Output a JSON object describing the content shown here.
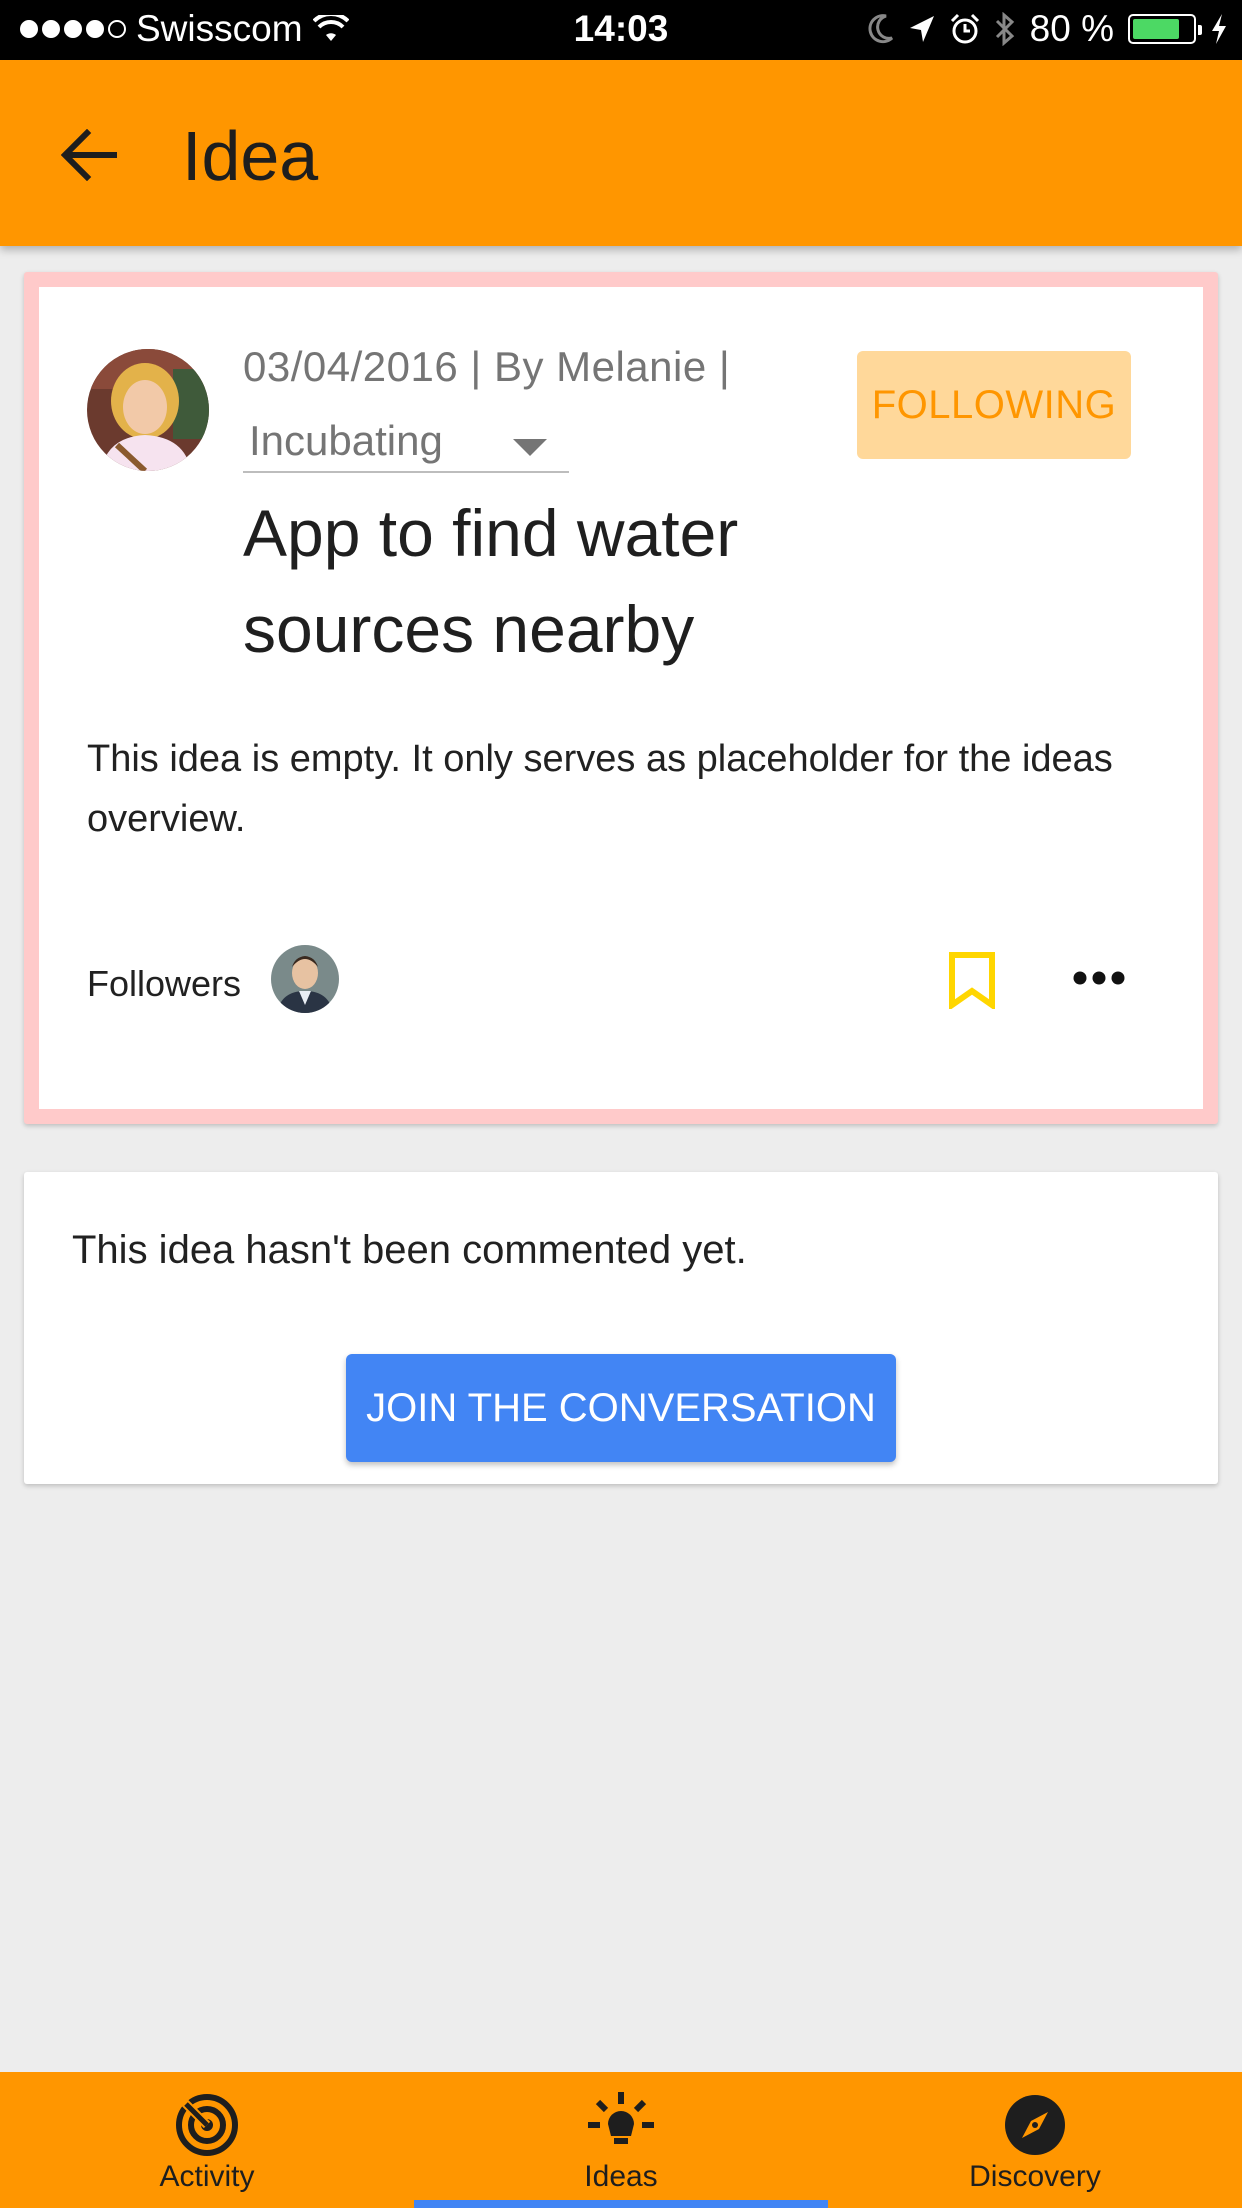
{
  "status_bar": {
    "carrier": "Swisscom",
    "time": "14:03",
    "battery_percent": "80 %",
    "battery_level": 0.8,
    "signal_bars_filled": 4,
    "signal_bars_total": 5
  },
  "app_bar": {
    "title": "Idea",
    "back_icon": "arrow-back-icon"
  },
  "idea": {
    "meta": "03/04/2016 | By Melanie |",
    "status": "Incubating",
    "follow_label": "FOLLOWING",
    "title": "App to find water sources nearby",
    "description": "This idea is empty. It only serves as placeholder for the ideas overview.",
    "followers_label": "Followers",
    "bookmark_icon": "bookmark-icon",
    "more_icon": "more-horiz-icon"
  },
  "comments": {
    "empty_text": "This idea hasn't been commented yet.",
    "join_label": "JOIN THE CONVERSATION"
  },
  "bottom_nav": {
    "items": [
      {
        "label": "Activity",
        "icon": "radar-icon"
      },
      {
        "label": "Ideas",
        "icon": "lightbulb-icon"
      },
      {
        "label": "Discovery",
        "icon": "compass-icon"
      }
    ],
    "active_index": 1
  },
  "colors": {
    "primary": "#ff9600",
    "accent": "#4285f4",
    "following_bg": "#ffd89a",
    "card_highlight": "#ffcaca",
    "bookmark": "#ffd600"
  }
}
